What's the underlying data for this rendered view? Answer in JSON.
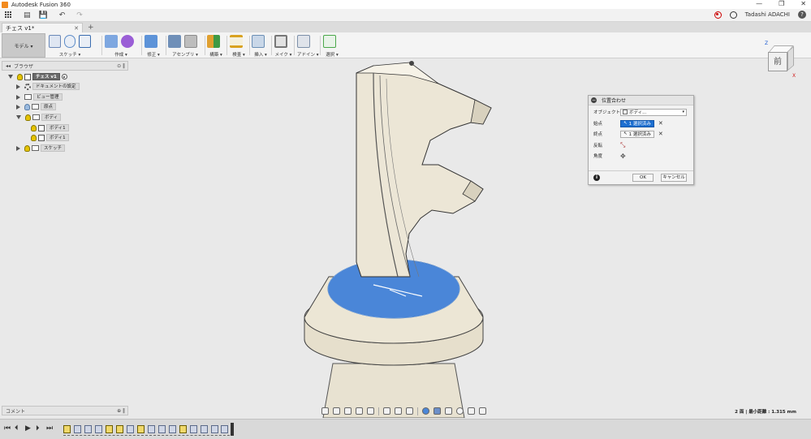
{
  "window": {
    "title": "Autodesk Fusion 360",
    "minimize": "—",
    "restore": "❐",
    "close": "✕"
  },
  "qat": {
    "file_glyph": "▤",
    "save_glyph": "💾",
    "undo_glyph": "↶",
    "redo_glyph": "↷",
    "user": "Tadashi ADACHI",
    "help_glyph": "?"
  },
  "tabs": [
    {
      "label": "チェス v1*"
    }
  ],
  "workspace": {
    "label": "モデル ▾"
  },
  "ribbon": {
    "groups": [
      {
        "label": "スケッチ ▾",
        "colors": [
          "#8aa9d6",
          "#5d8cc7",
          "#3b6db0"
        ]
      },
      {
        "label": "作成 ▾",
        "colors": [
          "#7ea7e0",
          "#9a5ed6"
        ]
      },
      {
        "label": "修正 ▾",
        "colors": [
          "#5d93d8"
        ]
      },
      {
        "label": "アセンブリ ▾",
        "colors": [
          "#6f8fb8",
          "#8c8c8c"
        ]
      },
      {
        "label": "構築 ▾",
        "colors": [
          "#e0a030"
        ]
      },
      {
        "label": "検査 ▾",
        "colors": [
          "#d9a220"
        ]
      },
      {
        "label": "挿入 ▾",
        "colors": [
          "#6b8fb5"
        ]
      },
      {
        "label": "メイク ▾",
        "colors": [
          "#777777"
        ]
      },
      {
        "label": "アドイン ▾",
        "colors": [
          "#7c8fa8"
        ]
      },
      {
        "label": "選択 ▾",
        "colors": [
          "#4aa84a"
        ]
      }
    ]
  },
  "browser": {
    "title": "ブラウザ",
    "ctrl": "⊙ ‖",
    "nodes": [
      {
        "label": "チェス v1"
      },
      {
        "label": "ドキュメントの設定"
      },
      {
        "label": "ビュー管理"
      },
      {
        "label": "原点"
      },
      {
        "label": "ボディ"
      },
      {
        "label": "ボディ1"
      },
      {
        "label": "ボディ1"
      },
      {
        "label": "スケッチ"
      }
    ]
  },
  "comment": {
    "label": "コメント",
    "ctrl": "⊕ ‖"
  },
  "viewcube": {
    "face": "前",
    "z_axis": "Z",
    "x_axis": "X"
  },
  "dialog": {
    "title": "位置合わせ",
    "object_label": "オブジェクト",
    "object_value": "ボディ...",
    "start_label": "始点",
    "start_value": "1 選択済み",
    "end_label": "終点",
    "end_value": "1 選択済み",
    "flip_label": "反転",
    "angle_label": "角度",
    "clear_glyph": "✕",
    "ok": "OK",
    "cancel": "キャンセル",
    "info_glyph": "i",
    "colors": {
      "accent": "#1d6fd0"
    }
  },
  "status": {
    "text": "2 面 | 最小距離 : 1.315 mm"
  },
  "timeline": {
    "first": "⏮",
    "prev": "⏴",
    "play": "▶",
    "next": "⏵",
    "last": "⏭"
  },
  "model": {
    "body_color": "#ece6d6",
    "selected_face_color": "#4a86d8"
  }
}
